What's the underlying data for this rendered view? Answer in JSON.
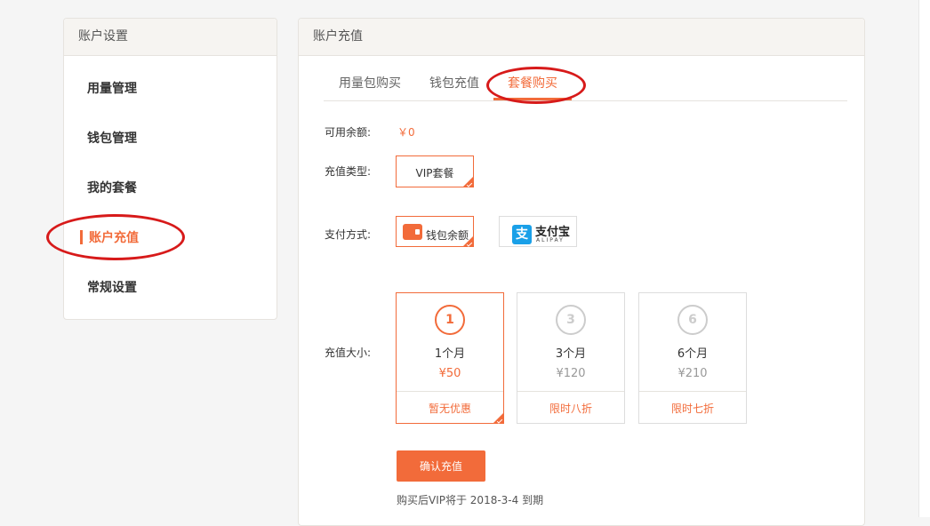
{
  "sidebar": {
    "title": "账户设置",
    "items": [
      {
        "label": "用量管理"
      },
      {
        "label": "钱包管理"
      },
      {
        "label": "我的套餐"
      },
      {
        "label": "账户充值"
      },
      {
        "label": "常规设置"
      }
    ],
    "active_index": 3
  },
  "main": {
    "title": "账户充值",
    "tabs": [
      {
        "label": "用量包购买"
      },
      {
        "label": "钱包充值"
      },
      {
        "label": "套餐购买"
      }
    ],
    "active_tab": 2
  },
  "form": {
    "balance_label": "可用余额:",
    "balance_value": "￥0",
    "type_label": "充值类型:",
    "type_option": "VIP套餐",
    "pay_label": "支付方式:",
    "pay_wallet": "钱包余额",
    "pay_alipay_cn": "支付宝",
    "pay_alipay_en": "ALIPAY",
    "amount_label": "充值大小:",
    "plans": [
      {
        "num": "1",
        "duration": "1个月",
        "price": "¥50",
        "discount": "暂无优惠",
        "selected": true
      },
      {
        "num": "3",
        "duration": "3个月",
        "price": "¥120",
        "discount": "限时八折",
        "selected": false
      },
      {
        "num": "6",
        "duration": "6个月",
        "price": "¥210",
        "discount": "限时七折",
        "selected": false
      }
    ],
    "confirm_label": "确认充值",
    "expire_note": "购买后VIP将于 2018-3-4 到期"
  },
  "colors": {
    "accent": "#f26b3a",
    "annotation": "#d71a1a",
    "alipay": "#1aa0e8"
  }
}
